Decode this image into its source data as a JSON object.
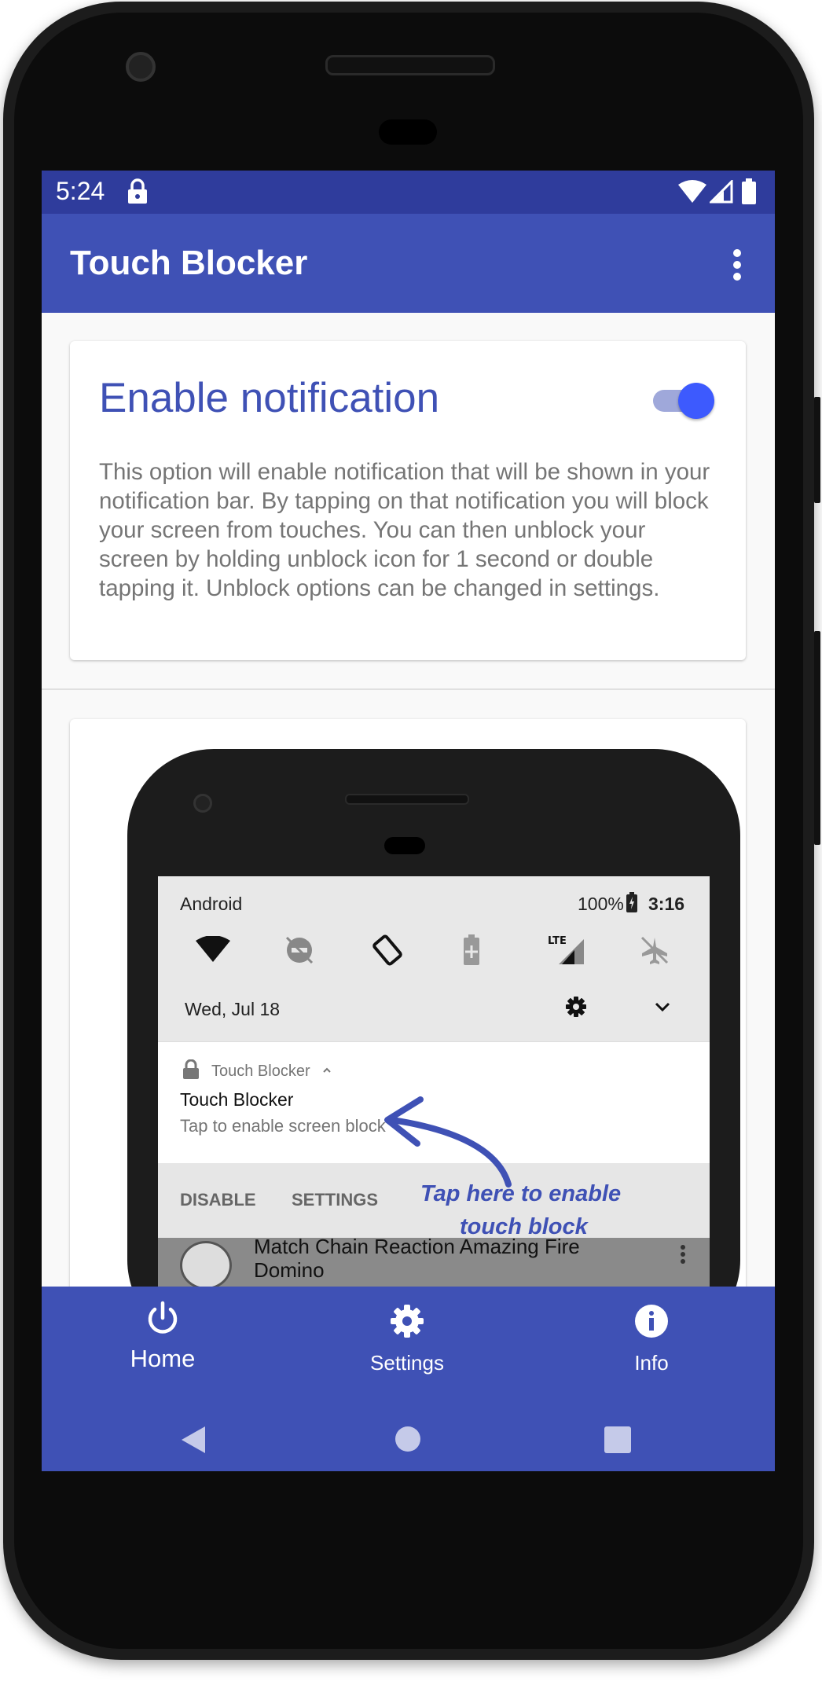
{
  "status_bar": {
    "time": "5:24"
  },
  "app_bar": {
    "title": "Touch Blocker"
  },
  "card1": {
    "title": "Enable notification",
    "toggle_on": true,
    "description": "This option will enable notification that will be shown in your notification bar. By tapping on that notification you will block your screen from touches. You can then unblock your screen by holding unblock icon for 1 second or double tapping it. Unblock options can be changed in settings."
  },
  "illustration": {
    "status_carrier": "Android",
    "status_battery": "100%",
    "status_time": "3:16",
    "date": "Wed, Jul 18",
    "notification": {
      "app_name": "Touch Blocker",
      "title": "Touch Blocker",
      "text": "Tap to enable screen block",
      "action_disable": "DISABLE",
      "action_settings": "SETTINGS"
    },
    "list_item_text_1": "Match Chain Reaction Amazing Fire",
    "list_item_text_2": "Domino",
    "annotation_line1": "Tap here to enable",
    "annotation_line2": "touch block"
  },
  "bottom_nav": {
    "home_label": "Home",
    "settings_label": "Settings",
    "info_label": "Info"
  },
  "colors": {
    "primary": "#3f51b5",
    "primary_dark": "#2f3c9c",
    "accent": "#3d5afe"
  }
}
